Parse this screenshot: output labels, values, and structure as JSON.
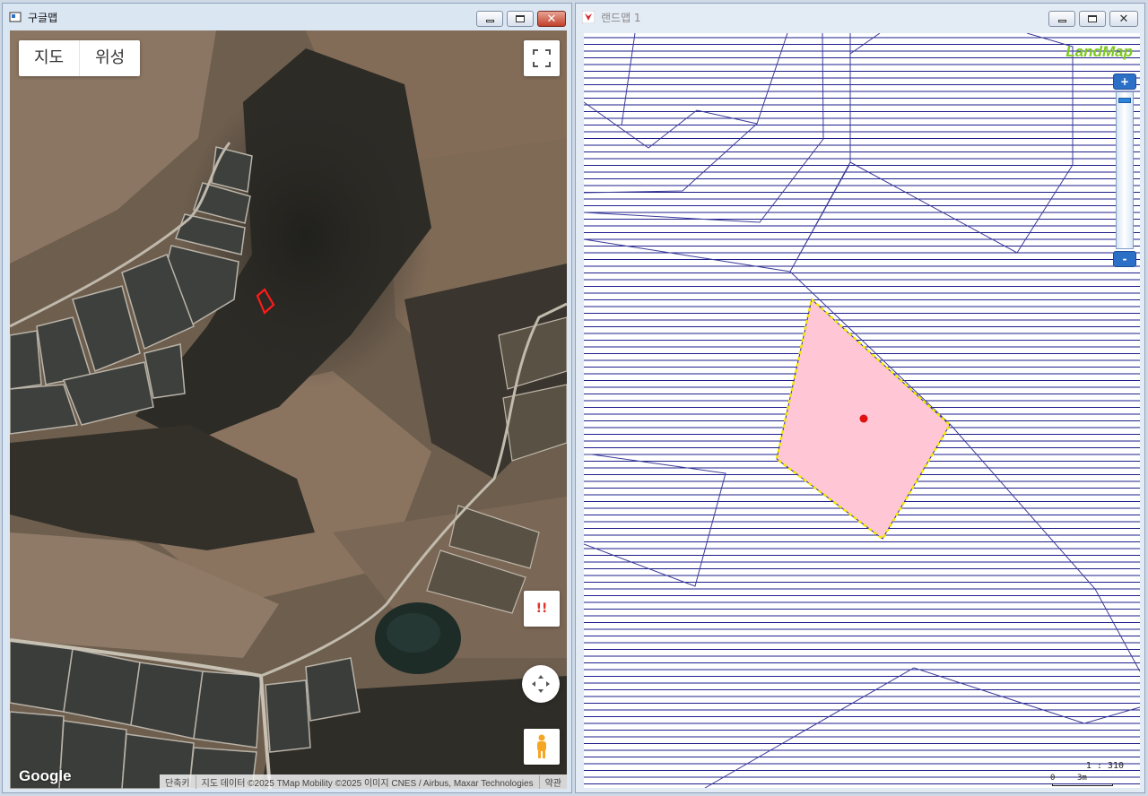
{
  "google_window": {
    "title": "구글맵",
    "map_type_buttons": [
      "지도",
      "위성"
    ],
    "report_button": "!!",
    "logo": "Google",
    "attribution": [
      "단축키",
      "지도 데이터 ©2025 TMap Mobility ©2025 이미지 CNES / Airbus, Maxar Technologies",
      "약관"
    ]
  },
  "landmap_window": {
    "title": "랜드맵 1",
    "logo": "LandMap",
    "zoom_in": "+",
    "zoom_out": "-",
    "scale_ratio": "1 : 310",
    "scale_bar": {
      "start": "0",
      "end": "3m"
    }
  },
  "colors": {
    "parcel_fill": "#ffc6d6",
    "parcel_outline": "#f2e600",
    "parcel_line": "#2a2a9e",
    "hatch": "#1e1e8c",
    "marker": "#e01010"
  }
}
